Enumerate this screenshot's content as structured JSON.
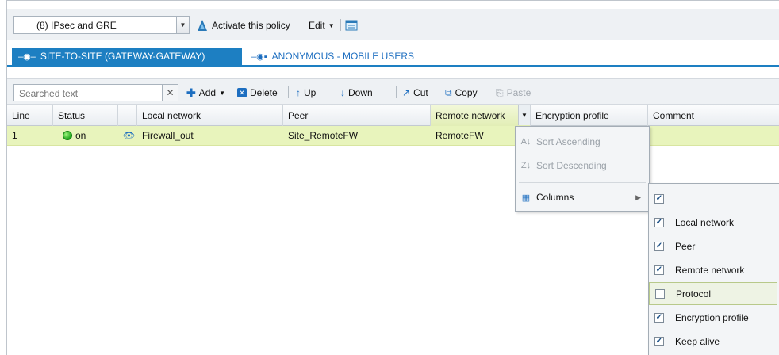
{
  "policy_bar": {
    "selected_policy": "(8) IPsec and GRE",
    "activate_label": "Activate this policy",
    "edit_label": "Edit"
  },
  "tabs": [
    {
      "label": "SITE-TO-SITE (GATEWAY-GATEWAY)",
      "active": true
    },
    {
      "label": "ANONYMOUS - MOBILE USERS",
      "active": false
    }
  ],
  "toolbar": {
    "search_placeholder": "Searched text",
    "add_label": "Add",
    "delete_label": "Delete",
    "up_label": "Up",
    "down_label": "Down",
    "cut_label": "Cut",
    "copy_label": "Copy",
    "paste_label": "Paste"
  },
  "columns": [
    "Line",
    "Status",
    "",
    "Local network",
    "Peer",
    "Remote network",
    "Encryption profile",
    "Comment"
  ],
  "rows": [
    {
      "line": "1",
      "status": "on",
      "local_network": "Firewall_out",
      "peer": "Site_RemoteFW",
      "remote_network": "RemoteFW",
      "encryption_profile": "",
      "comment": ""
    }
  ],
  "context_menu": {
    "items": [
      {
        "label": "Sort Ascending",
        "enabled": false
      },
      {
        "label": "Sort Descending",
        "enabled": false
      },
      {
        "label": "Columns",
        "enabled": true
      }
    ]
  },
  "columns_menu": {
    "items": [
      {
        "label": "",
        "checked": true
      },
      {
        "label": "Local network",
        "checked": true
      },
      {
        "label": "Peer",
        "checked": true
      },
      {
        "label": "Remote network",
        "checked": true
      },
      {
        "label": "Protocol",
        "checked": false
      },
      {
        "label": "Encryption profile",
        "checked": true
      },
      {
        "label": "Keep alive",
        "checked": true
      }
    ]
  },
  "colors": {
    "accent": "#1d7fc2",
    "row_selected": "#e8f4bc",
    "status_on": "#1ea51a"
  }
}
